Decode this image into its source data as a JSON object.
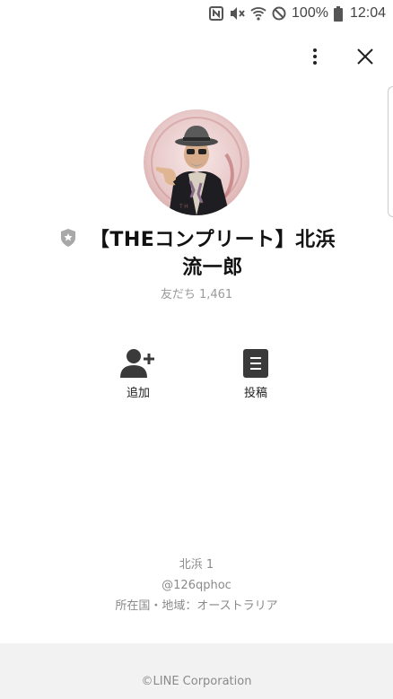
{
  "status_bar": {
    "battery": "100%",
    "time": "12:04",
    "icons": [
      "nfc-icon",
      "mute-icon",
      "wifi-icon",
      "block-icon",
      "battery-icon"
    ]
  },
  "header": {
    "menu_icon": "more-vertical-icon",
    "close_icon": "close-icon"
  },
  "profile": {
    "name": "【THEコンプリート】北浜流一郎",
    "friends": "友だち 1,461",
    "badge": "official-shield-star-icon"
  },
  "actions": {
    "add_label": "追加",
    "post_label": "投稿"
  },
  "info": {
    "line1": "北浜 1",
    "line2": "@126qphoc",
    "line3": "所在国・地域：オーストラリア"
  },
  "footer": {
    "copyright": "©LINE Corporation"
  },
  "colors": {
    "icon_dark": "#3a3a3a",
    "muted_text": "#9a9a9a",
    "footer_bg": "#f2f2f2"
  }
}
